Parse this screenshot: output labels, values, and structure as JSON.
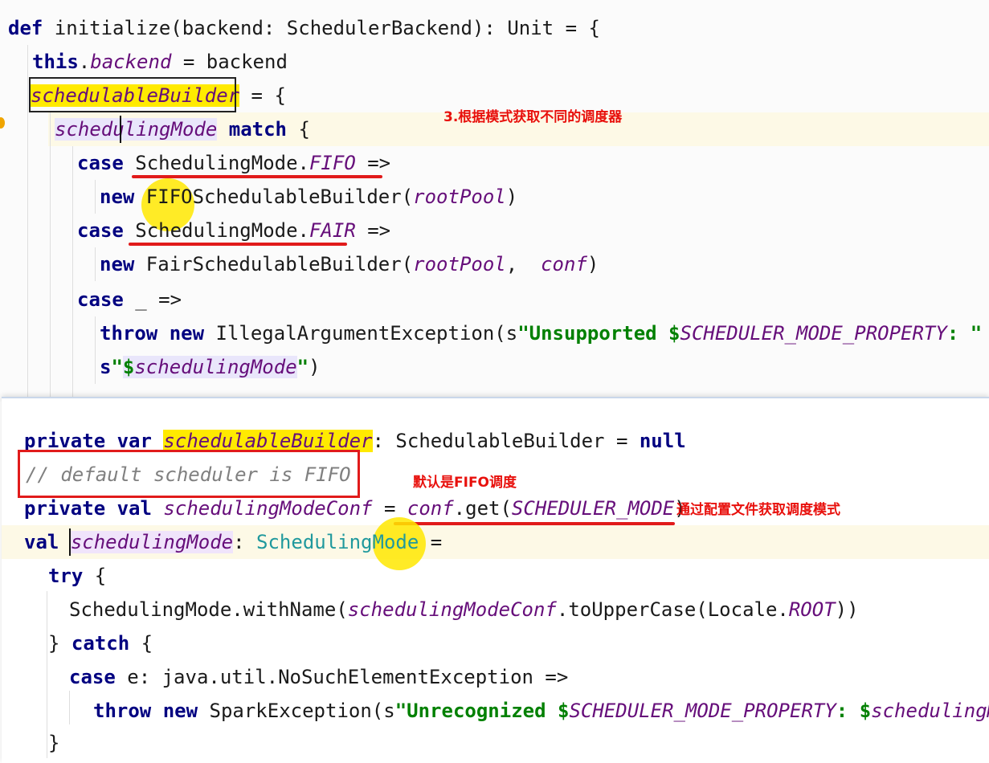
{
  "top_code": {
    "l1": [
      "def",
      " initialize(backend: SchedulerBackend): Unit = {"
    ],
    "l2": [
      "this",
      ".",
      "backend",
      " = backend"
    ],
    "l3": [
      "schedulableBuilder",
      " = {"
    ],
    "l4": [
      "schedulingMode",
      " ",
      "match",
      " {"
    ],
    "l5": [
      "case",
      " SchedulingMode.",
      "FIFO",
      " =>"
    ],
    "l6": [
      "new",
      " FIFOSchedulableBuilder(",
      "rootPool",
      ")"
    ],
    "l7": [
      "case",
      " SchedulingMode.",
      "FAIR",
      " =>"
    ],
    "l8": [
      "new",
      " FairSchedulableBuilder(",
      "rootPool",
      ",  ",
      "conf",
      ")"
    ],
    "l9": [
      "case",
      " _ =>"
    ],
    "l10": [
      "throw",
      " ",
      "new",
      " IllegalArgumentException(s",
      "\"Unsupported ",
      "$",
      "SCHEDULER_MODE_PROPERTY",
      ": \"",
      " +"
    ],
    "l11": [
      "s",
      "\"",
      "$",
      "schedulingMode",
      "\"",
      ")"
    ]
  },
  "bottom_code": {
    "l1": [
      "private",
      " ",
      "var",
      " ",
      "schedulableBuilder",
      ": SchedulableBuilder = ",
      "null"
    ],
    "l2": [
      "// default scheduler is FIFO"
    ],
    "l3": [
      "private",
      " ",
      "val",
      " ",
      "schedulingModeConf",
      " = ",
      "conf",
      ".get(",
      "SCHEDULER_MODE",
      ")"
    ],
    "l4": [
      "val",
      " ",
      "schedulingMode",
      ": ",
      "SchedulingMode",
      " ="
    ],
    "l5": [
      "try",
      " {"
    ],
    "l6": [
      "SchedulingMode.withName(",
      "schedulingModeConf",
      ".toUpperCase(Locale.",
      "ROOT",
      "))"
    ],
    "l7": [
      "}",
      " ",
      "catch",
      " {"
    ],
    "l8": [
      "case",
      " e: java.util.NoSuchElementException =>"
    ],
    "l9": [
      "throw",
      " ",
      "new",
      " SparkException(s",
      "\"Unrecognized ",
      "$",
      "SCHEDULER_MODE_PROPERTY",
      ": ",
      "$",
      "schedulingMo"
    ],
    "l10": [
      "}"
    ]
  },
  "annotations": {
    "note1": "3.根据模式获取不同的调度器",
    "note2": "默认是FIFO调度",
    "note3": "通过配置文件获取调度模式"
  },
  "colors": {
    "keyword": "#000080",
    "field": "#660e7a",
    "string": "#008000",
    "comment": "#808080",
    "type": "#20999d",
    "annotation": "#e8100c",
    "highlight": "#ffea00"
  }
}
